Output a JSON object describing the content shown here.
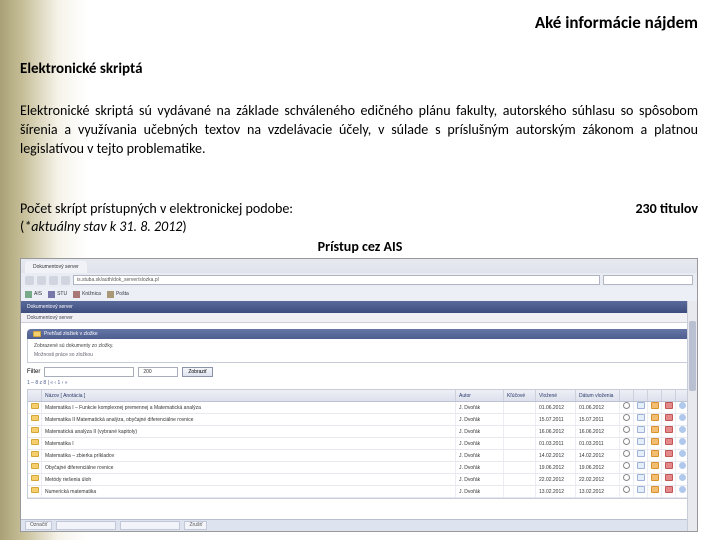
{
  "page_title": "Aké informácie nájdem",
  "section_title": "Elektronické skriptá",
  "description": "Elektronické skriptá sú vydávané na základe schváleného edičného plánu fakulty, autorského súhlasu so spôsobom šírenia a využívania učebných textov na vzdelávacie účely, v súlade s príslušným autorským zákonom a platnou legislatívou v tejto problematike.",
  "count_label": "Počet skrípt prístupných v elektronickej podobe:",
  "count_value": "230 titulov",
  "note_prefix": "(",
  "note_italic": "*aktuálny stav k 31. 8. 2012",
  "note_suffix": ")",
  "access_label": "Prístup cez AIS",
  "browser": {
    "tabs": [
      {
        "label": "Dokumentový server"
      }
    ],
    "address": "is.stuba.sk/auth/dok_server/slozka.pl",
    "bookmarks": [
      "AIS",
      "STU",
      "Knižnica",
      "Pošta"
    ]
  },
  "ais": {
    "header_left": "Dokumentový server",
    "header_right": "",
    "breadcrumb": "Dokumentový server",
    "pill_title": "Prehľad zložiek v zložke",
    "pill_line1": "Zobrazené sú dokumenty zo zložky.",
    "pill_line2": "Možnosti práce so zložkou",
    "filter_label": "Filter",
    "filter_value": "",
    "per_page": "200",
    "go_btn": "Zobraziť",
    "pager": "1 – 8 z 8   |  «  ‹  1  ›  »",
    "columns": [
      "",
      "Názov [ Anotácia ]",
      "Autor",
      "Kľúčové",
      "Vložené",
      "Dátum vloženia",
      "",
      "",
      "",
      "",
      ""
    ],
    "rows": [
      {
        "name": "Matematika I – Funkcie komplexnej premennej a Matematická analýza",
        "author": "J. Dvořák",
        "kw": "",
        "d1": "01.06.2012",
        "d2": "01.06.2012"
      },
      {
        "name": "Matematika II Matematická analýza, obyčajné diferenciálne rovnice",
        "author": "J. Dvořák",
        "kw": "",
        "d1": "15.07.2011",
        "d2": "15.07.2011"
      },
      {
        "name": "Matematická analýza II (vybrané kapitoly)",
        "author": "J. Dvořák",
        "kw": "",
        "d1": "16.06.2012",
        "d2": "16.06.2012"
      },
      {
        "name": "Matematika I",
        "author": "J. Dvořák",
        "kw": "",
        "d1": "01.03.2011",
        "d2": "01.03.2011"
      },
      {
        "name": "Matematika – zbierka príkladov",
        "author": "J. Dvořák",
        "kw": "",
        "d1": "14.02.2012",
        "d2": "14.02.2012"
      },
      {
        "name": "Obyčajné diferenciálne rovnice",
        "author": "J. Dvořák",
        "kw": "",
        "d1": "19.06.2012",
        "d2": "19.06.2012"
      },
      {
        "name": "Metódy riešenia úloh",
        "author": "J. Dvořák",
        "kw": "",
        "d1": "22.02.2012",
        "d2": "22.02.2012"
      },
      {
        "name": "Numerická matematika",
        "author": "J. Dvořák",
        "kw": "",
        "d1": "13.02.2012",
        "d2": "13.02.2012"
      }
    ],
    "bottom": [
      "Označiť",
      "",
      "",
      "Zrušiť"
    ]
  }
}
